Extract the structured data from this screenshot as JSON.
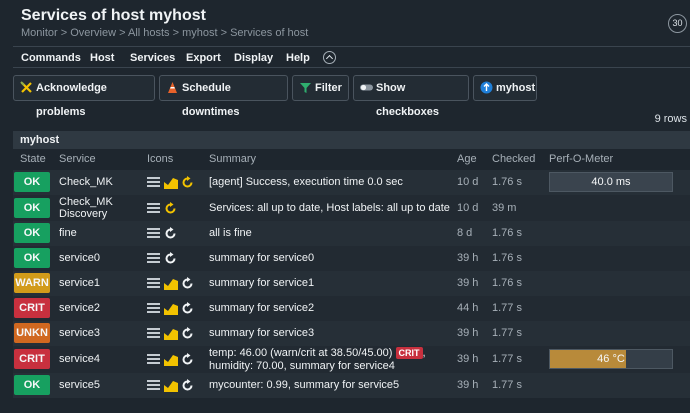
{
  "page": {
    "title": "Services of host myhost",
    "breadcrumb": "Monitor > Overview > All hosts > myhost > Services of host",
    "refresh_seconds": "30"
  },
  "menu": [
    "Commands",
    "Host",
    "Services",
    "Export",
    "Display",
    "Help"
  ],
  "buttons": {
    "acknowledge": "Acknowledge problems",
    "schedule": "Schedule downtimes",
    "filter": "Filter",
    "checkboxes": "Show checkboxes",
    "host": "myhost"
  },
  "rows_count": "9 rows",
  "host_group": "myhost",
  "columns": [
    "State",
    "Service",
    "Icons",
    "Summary",
    "Age",
    "Checked",
    "Perf-O-Meter"
  ],
  "colors": {
    "ok": "#17a060",
    "warn": "#d29b1a",
    "crit": "#c8303e",
    "unkn": "#d06820",
    "perf_gray": "#3a444e",
    "perf_temp": "#b88a3a"
  },
  "services": [
    {
      "state": "OK",
      "name": "Check_MK",
      "summary": "[agent] Success, execution time 0.0 sec",
      "age": "10 d",
      "checked": "1.76 s",
      "perf": "40.0 ms",
      "icons": [
        "menu-icon",
        "graph-icon",
        "reload-icon"
      ]
    },
    {
      "state": "OK",
      "name_l1": "Check_MK",
      "name_l2": "Discovery",
      "summary": "Services: all up to date, Host labels: all up to date",
      "age": "10 d",
      "checked": "39 m",
      "icons": [
        "menu-icon",
        "reload-icon"
      ]
    },
    {
      "state": "OK",
      "name": "fine",
      "summary": "all is fine",
      "age": "8 d",
      "checked": "1.76 s",
      "icons": [
        "menu-icon",
        "reload-icon"
      ]
    },
    {
      "state": "OK",
      "name": "service0",
      "summary": "summary for service0",
      "age": "39 h",
      "checked": "1.76 s",
      "icons": [
        "menu-icon",
        "reload-icon"
      ]
    },
    {
      "state": "WARN",
      "name": "service1",
      "summary": "summary for service1",
      "age": "39 h",
      "checked": "1.76 s",
      "icons": [
        "menu-icon",
        "graph-icon",
        "reload-icon"
      ]
    },
    {
      "state": "CRIT",
      "name": "service2",
      "summary": "summary for service2",
      "age": "44 h",
      "checked": "1.77 s",
      "icons": [
        "menu-icon",
        "graph-icon",
        "reload-icon"
      ]
    },
    {
      "state": "UNKN",
      "name": "service3",
      "summary": "summary for service3",
      "age": "39 h",
      "checked": "1.77 s",
      "icons": [
        "menu-icon",
        "graph-icon",
        "reload-icon"
      ]
    },
    {
      "state": "CRIT",
      "name": "service4",
      "summary_l1a": "temp: 46.00 (warn/crit at 38.50/45.00)",
      "summary_badge": "CRIT",
      "summary_l1b": ",",
      "summary_l2": "humidity: 70.00, summary for service4",
      "age": "39 h",
      "checked": "1.77 s",
      "perf": "46 °C",
      "perf_fill_fraction": 0.62,
      "icons": [
        "menu-icon",
        "graph-icon",
        "reload-icon"
      ]
    },
    {
      "state": "OK",
      "name": "service5",
      "summary": "mycounter: 0.99, summary for service5",
      "age": "39 h",
      "checked": "1.77 s",
      "icons": [
        "menu-icon",
        "graph-icon",
        "reload-icon"
      ]
    }
  ]
}
